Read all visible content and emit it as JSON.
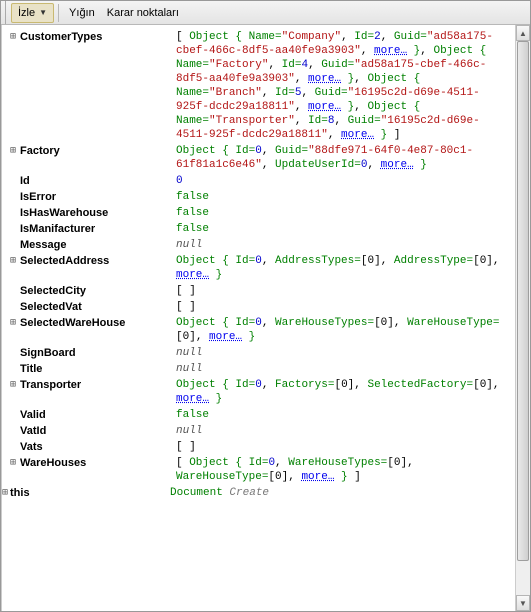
{
  "toolbar": {
    "izle": "İzle",
    "yigin": "Yığın",
    "karar": "Karar noktaları"
  },
  "rows": {
    "customerTypes": {
      "name": "CustomerTypes",
      "v1": "[ ",
      "obj": "Object { ",
      "nameProp": "Name=",
      "company": "\"Company\"",
      "idProp": "Id=",
      "id2": "2",
      "guidProp": "Guid=",
      "guidA": "\"ad58a175-cbef-466c-8df5-aa40fe9a3903\"",
      "more": "more…",
      "close": " }",
      "comma": ", ",
      "factory": "\"Factory\"",
      "id4": "4",
      "branch": "\"Branch\"",
      "id5": "5",
      "guidB": "\"16195c2d-d69e-4511-925f-dcdc29a18811\"",
      "transporter": "\"Transporter\"",
      "id8": "8",
      "endBracket": " ]"
    },
    "factory": {
      "name": "Factory",
      "id0": "0",
      "guid": "\"88dfe971-64f0-4e87-80c1-61f81a1c6e46\"",
      "updateUserProp": "UpdateUserId="
    },
    "id": {
      "name": "Id",
      "val": "0"
    },
    "isError": {
      "name": "IsError",
      "val": "false"
    },
    "isHasWarehouse": {
      "name": "IsHasWarehouse",
      "val": "false"
    },
    "isManifacturer": {
      "name": "IsManifacturer",
      "val": "false"
    },
    "message": {
      "name": "Message",
      "val": "null"
    },
    "selectedAddress": {
      "name": "SelectedAddress",
      "addrTypesProp": "AddressTypes=",
      "addrTypeProp": "AddressType=",
      "emptyArr": "[0]"
    },
    "selectedCity": {
      "name": "SelectedCity",
      "val": "[  ]"
    },
    "selectedVat": {
      "name": "SelectedVat",
      "val": "[  ]"
    },
    "selectedWareHouse": {
      "name": "SelectedWareHouse",
      "whTypesProp": "WareHouseTypes=",
      "whTypeProp": "WareHouseType="
    },
    "signBoard": {
      "name": "SignBoard",
      "val": "null"
    },
    "title": {
      "name": "Title",
      "val": "null"
    },
    "transporter": {
      "name": "Transporter",
      "factorysProp": "Factorys=",
      "selFactoryProp": "SelectedFactory="
    },
    "valid": {
      "name": "Valid",
      "val": "false"
    },
    "vatId": {
      "name": "VatId",
      "val": "null"
    },
    "vats": {
      "name": "Vats",
      "val": "[  ]"
    },
    "wareHouses": {
      "name": "WareHouses"
    },
    "this": {
      "name": "this",
      "docWord": "Document",
      "createWord": " Create"
    }
  }
}
